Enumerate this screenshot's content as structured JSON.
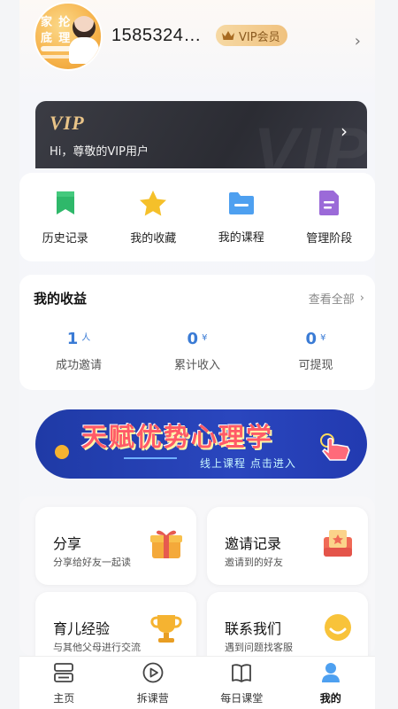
{
  "header": {
    "avatar_line1": "家 抡",
    "avatar_line2": "底 理",
    "username": "1585324…",
    "vip_badge": "VIP会员"
  },
  "vip_card": {
    "logo": "VIP",
    "subtitle": "Hi，尊敬的VIP用户",
    "watermark": "VIP"
  },
  "quick_menu": [
    {
      "label": "历史记录",
      "icon": "bookmark-icon",
      "color": "#2fb86a"
    },
    {
      "label": "我的收藏",
      "icon": "star-icon",
      "color": "#f5c02a"
    },
    {
      "label": "我的课程",
      "icon": "folder-icon",
      "color": "#4ea0f0"
    },
    {
      "label": "管理阶段",
      "icon": "document-icon",
      "color": "#9b6ad8"
    }
  ],
  "earnings": {
    "title": "我的收益",
    "more": "查看全部",
    "stats": [
      {
        "value": "1",
        "unit": "人",
        "label": "成功邀请"
      },
      {
        "value": "0",
        "unit": "¥",
        "label": "累计收入"
      },
      {
        "value": "0",
        "unit": "¥",
        "label": "可提现"
      }
    ]
  },
  "banner": {
    "title": "天赋优势心理学",
    "subtitle": "线上课程  点击进入"
  },
  "actions": [
    {
      "title": "分享",
      "subtitle": "分享给好友一起读",
      "icon": "gift-icon"
    },
    {
      "title": "邀请记录",
      "subtitle": "邀请到的好友",
      "icon": "invite-record-icon"
    },
    {
      "title": "育儿经验",
      "subtitle": "与其他父母进行交流",
      "icon": "trophy-icon"
    },
    {
      "title": "联系我们",
      "subtitle": "遇到问题找客服",
      "icon": "chat-icon"
    }
  ],
  "tabbar": [
    {
      "label": "主页",
      "icon": "home-icon"
    },
    {
      "label": "拆课营",
      "icon": "play-icon"
    },
    {
      "label": "每日课堂",
      "icon": "book-icon"
    },
    {
      "label": "我的",
      "icon": "user-icon",
      "active": true
    }
  ],
  "colors": {
    "accent_blue": "#3a7bd5",
    "vip_gold": "#e9c488",
    "vip_dark": "#2b2c33"
  }
}
